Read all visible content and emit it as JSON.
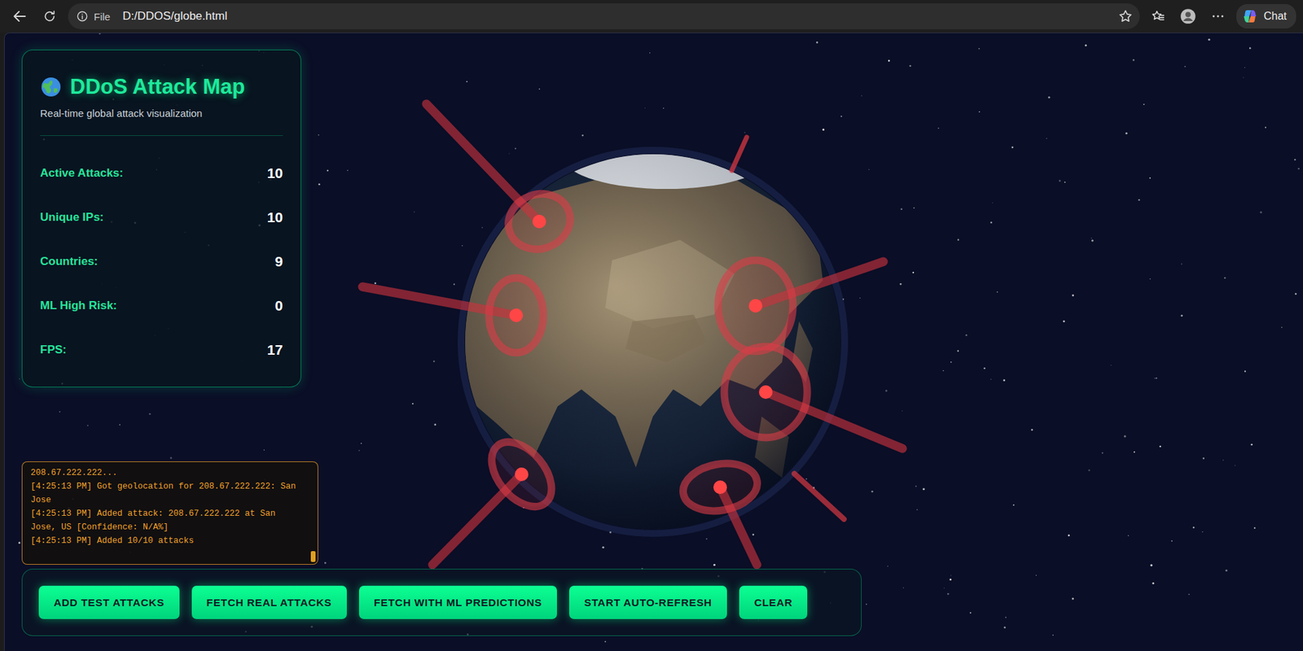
{
  "browser": {
    "file_label": "File",
    "url": "D:/DDOS/globe.html",
    "chat_label": "Chat"
  },
  "panel": {
    "title": "DDoS Attack Map",
    "subtitle": "Real-time global attack visualization",
    "stats": [
      {
        "label": "Active Attacks:",
        "value": "10"
      },
      {
        "label": "Unique IPs:",
        "value": "10"
      },
      {
        "label": "Countries:",
        "value": "9"
      },
      {
        "label": "ML High Risk:",
        "value": "0"
      },
      {
        "label": "FPS:",
        "value": "17"
      }
    ]
  },
  "log": {
    "scroll_position": 1,
    "lines": [
      "208.67.222.222...",
      "[4:25:13 PM] Got geolocation for 208.67.222.222: San Jose",
      "[4:25:13 PM] Added attack: 208.67.222.222 at San Jose, US [Confidence: N/A%]",
      "[4:25:13 PM] Added 10/10 attacks"
    ]
  },
  "buttons": [
    "ADD TEST ATTACKS",
    "FETCH REAL ATTACKS",
    "FETCH WITH ML PREDICTIONS",
    "START AUTO-REFRESH",
    "CLEAR"
  ]
}
